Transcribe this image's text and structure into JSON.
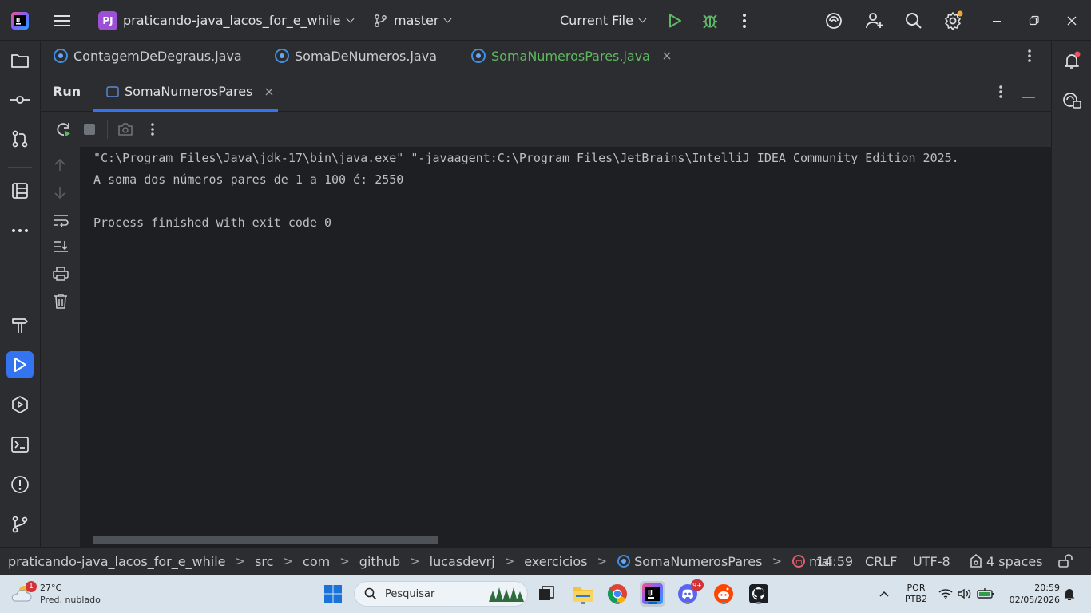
{
  "titlebar": {
    "project_badge": "PJ",
    "project_name": "praticando-java_lacos_for_e_while",
    "branch": "master",
    "run_config": "Current File",
    "icons": [
      "intellij-logo-icon",
      "hamburger-menu-icon",
      "git-branch-icon",
      "run-icon",
      "debug-icon",
      "more-vertical-icon",
      "ai-assistant-icon",
      "add-user-icon",
      "search-icon",
      "settings-icon",
      "minimize-icon",
      "restore-icon",
      "close-icon"
    ]
  },
  "editor_tabs": [
    {
      "label": "ContagemDeDegraus.java",
      "active": false
    },
    {
      "label": "SomaDeNumeros.java",
      "active": false
    },
    {
      "label": "SomaNumerosPares.java",
      "active": true
    }
  ],
  "run_window": {
    "title": "Run",
    "tab_label": "SomaNumerosPares"
  },
  "console": {
    "lines": [
      "\"C:\\Program Files\\Java\\jdk-17\\bin\\java.exe\" \"-javaagent:C:\\Program Files\\JetBrains\\IntelliJ IDEA Community Edition 2025.",
      "A soma dos números pares de 1 a 100 é: 2550",
      "",
      "Process finished with exit code 0"
    ]
  },
  "statusbar": {
    "breadcrumbs": [
      "praticando-java_lacos_for_e_while",
      "src",
      "com",
      "github",
      "lucasdevrj",
      "exercicios",
      "SomaNumerosPares",
      "mai"
    ],
    "cursor_position": "14:59",
    "line_separator": "CRLF",
    "encoding": "UTF-8",
    "indent": "4 spaces"
  },
  "taskbar": {
    "weather_temp": "27°C",
    "weather_desc": "Pred. nublado",
    "weather_badge": "1",
    "search_placeholder": "Pesquisar",
    "discord_badge": "9+",
    "lang_top": "POR",
    "lang_bottom": "PTB2",
    "time": "20:59",
    "date": "02/05/2026"
  },
  "colors": {
    "accent": "#3574f0",
    "active_tab_text": "#5fb85f",
    "run_green": "#5fb865"
  }
}
